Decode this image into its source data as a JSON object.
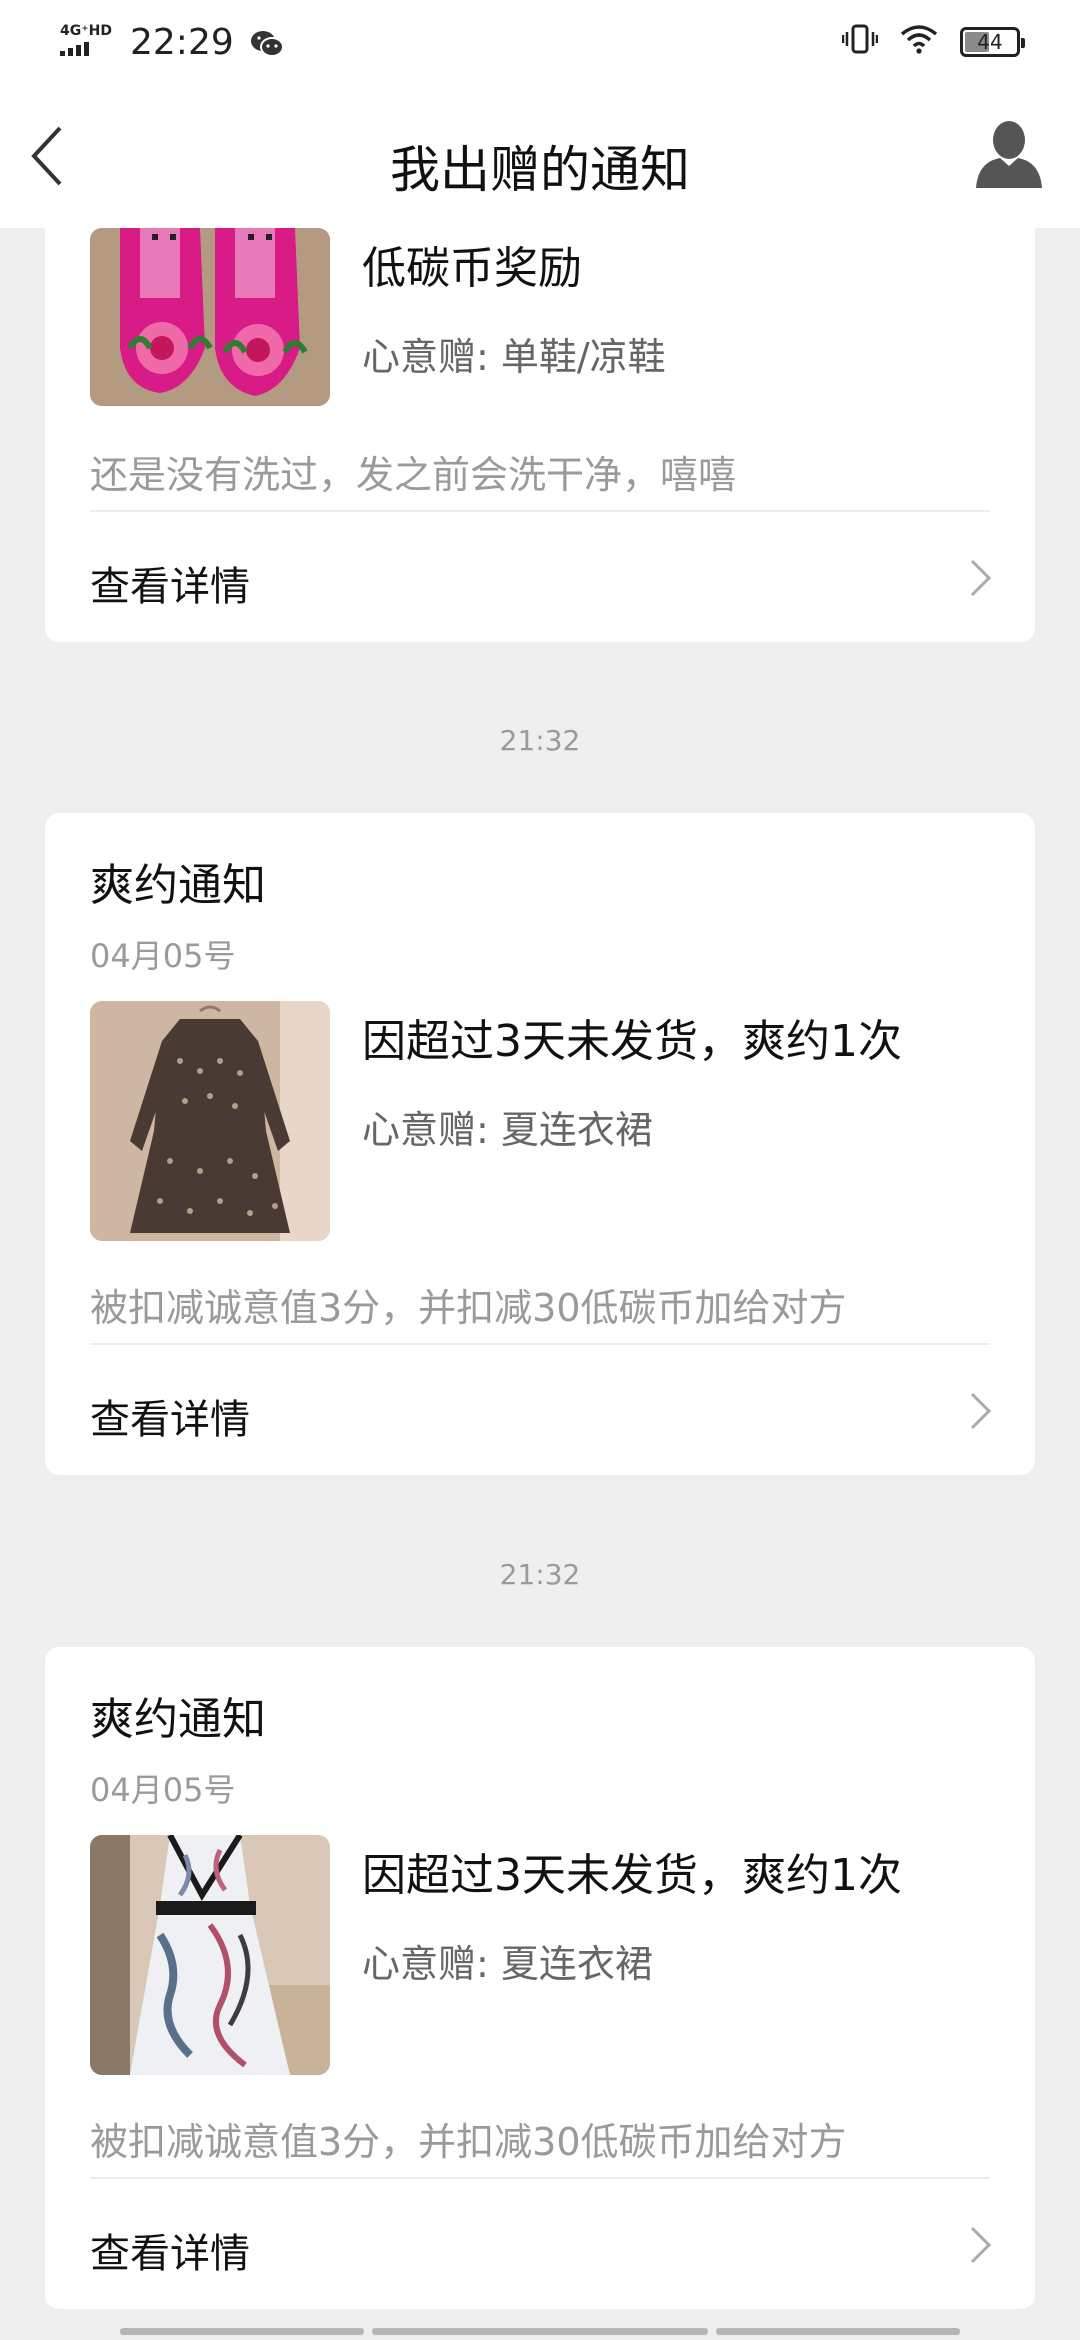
{
  "status_bar": {
    "network": "4G⁺HD",
    "time": "22:29",
    "battery": "44"
  },
  "nav": {
    "title": "我出赠的通知"
  },
  "cards": [
    {
      "headline": "低碳币奖励",
      "category": "心意赠: 单鞋/凉鞋",
      "description": "还是没有洗过，发之前会洗干净，嘻嘻",
      "detail_label": "查看详情"
    },
    {
      "timestamp": "21:32",
      "title": "爽约通知",
      "date": "04月05号",
      "headline": "因超过3天未发货，爽约1次",
      "category": "心意赠: 夏连衣裙",
      "description": "被扣减诚意值3分，并扣减30低碳币加给对方",
      "detail_label": "查看详情"
    },
    {
      "timestamp": "21:32",
      "title": "爽约通知",
      "date": "04月05号",
      "headline": "因超过3天未发货，爽约1次",
      "category": "心意赠: 夏连衣裙",
      "description": "被扣减诚意值3分，并扣减30低碳币加给对方",
      "detail_label": "查看详情"
    }
  ]
}
